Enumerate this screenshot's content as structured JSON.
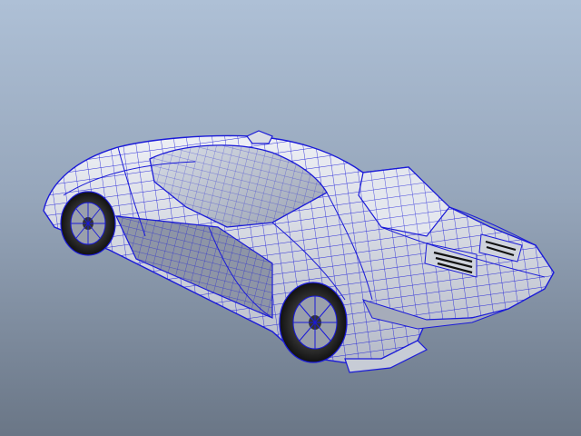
{
  "viewport": {
    "background_top": "#aec0d6",
    "background_bottom": "#6a7686",
    "wire_color": "#1a1ad8",
    "surface_color": "#dadde6",
    "shadow_color": "#9ea4b4",
    "glass_color": "#c4cad6",
    "tire_color": "#2a2a2a"
  },
  "model": {
    "subject": "sports-car-wireframe"
  }
}
